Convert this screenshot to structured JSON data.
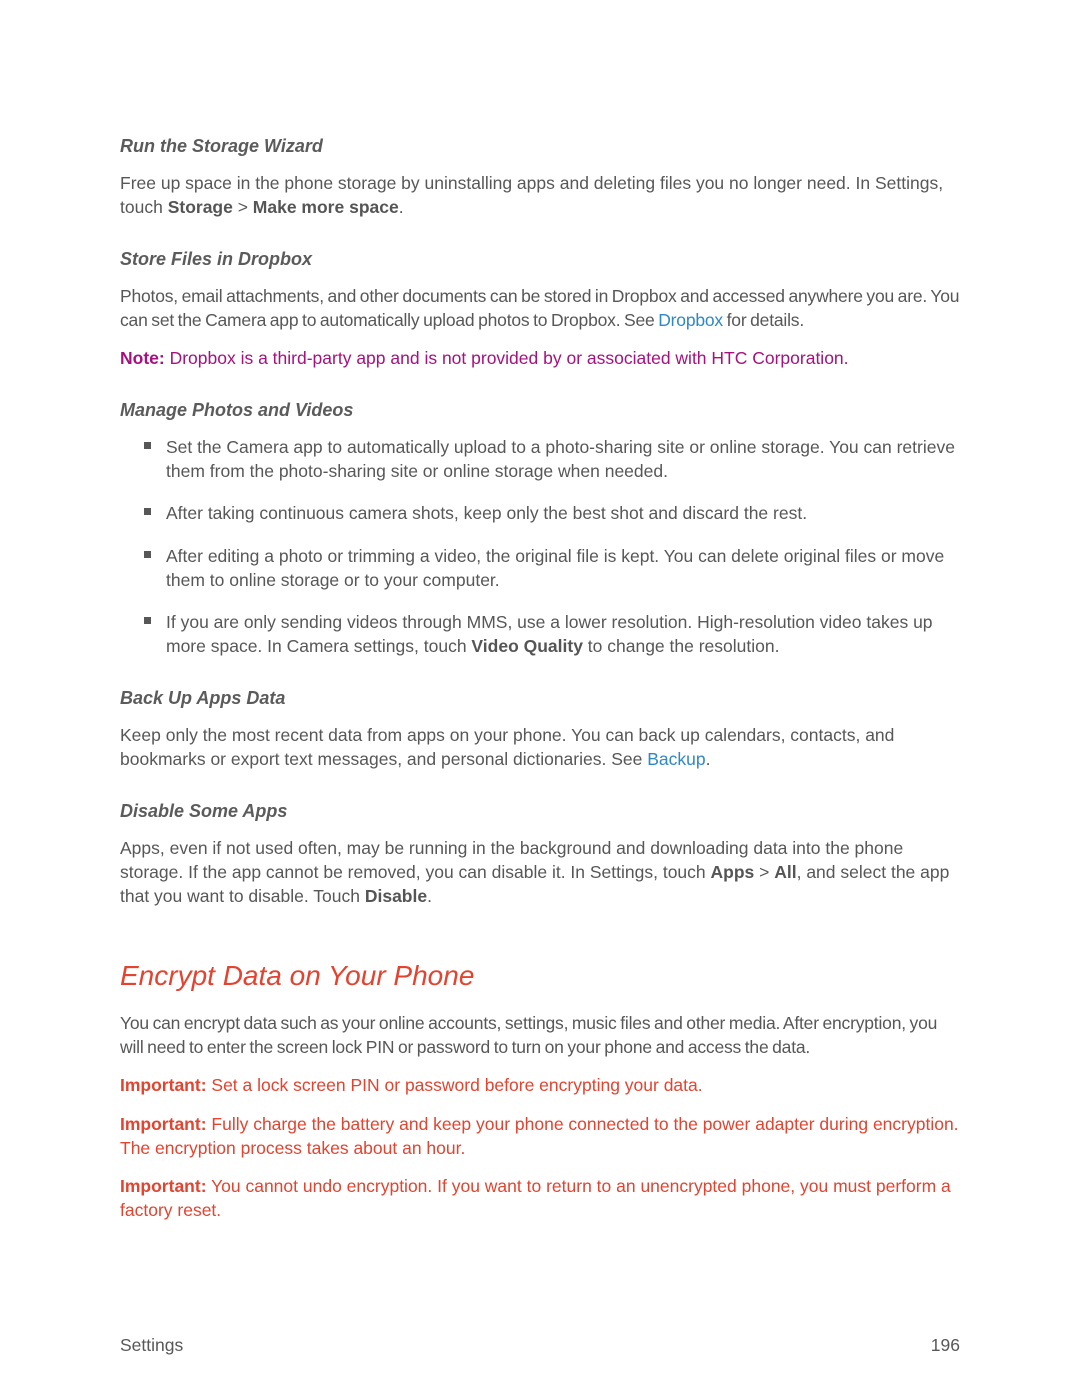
{
  "sections": {
    "storage_wizard": {
      "heading": "Run the Storage Wizard",
      "p1_a": "Free up space in the phone storage by uninstalling apps and deleting files you no longer need. In Settings, touch ",
      "p1_b1": "Storage",
      "p1_gt": " > ",
      "p1_b2": "Make more space",
      "p1_c": "."
    },
    "dropbox": {
      "heading": "Store Files in Dropbox",
      "p1_a": "Photos, email attachments, and other documents can be stored in Dropbox and accessed anywhere you are. You can set the Camera app to automatically upload photos to Dropbox. See ",
      "p1_link": "Dropbox",
      "p1_b": " for details.",
      "note_label": "Note:",
      "note_body": "  Dropbox is a third-party app and is not provided by or associated with HTC Corporation."
    },
    "photos": {
      "heading": "Manage Photos and Videos",
      "items": [
        "Set the Camera app to automatically upload to a photo-sharing site or online storage. You can retrieve them from the photo-sharing site or online storage when needed.",
        "After taking continuous camera shots, keep only the best shot and discard the rest.",
        "After editing a photo or trimming a video, the original file is kept. You can delete original files or move them to online storage or to your computer."
      ],
      "item4_a": "If you are only sending videos through MMS, use a lower resolution. High-resolution video takes up more space. In Camera settings, touch ",
      "item4_b": "Video Quality",
      "item4_c": " to change the resolution."
    },
    "backup": {
      "heading": "Back Up Apps Data",
      "p1_a": "Keep only the most recent data from apps on your phone. You can back up calendars, contacts, and bookmarks or export text messages, and personal dictionaries. See ",
      "p1_link": "Backup",
      "p1_b": "."
    },
    "disable": {
      "heading": "Disable Some Apps",
      "p1_a": "Apps, even if not used often, may be running in the background and downloading data into the phone storage. If the app cannot be removed, you can disable it. In Settings, touch ",
      "p1_b1": "Apps",
      "p1_gt": " > ",
      "p1_b2": "All",
      "p1_c": ", and select the app that you want to disable. Touch ",
      "p1_b3": "Disable",
      "p1_d": "."
    },
    "encrypt": {
      "heading": "Encrypt Data on Your Phone",
      "p1": "You can encrypt data such as your online accounts, settings, music files and other media. After encryption, you will need to enter the screen lock PIN or password to turn on your phone and access the data.",
      "imp_label": "Important:",
      "imp1": "  Set a lock screen PIN or password before encrypting your data.",
      "imp2": "  Fully charge the battery and keep your phone connected to the power adapter during encryption. The encryption process takes about an hour.",
      "imp3": "  You cannot undo encryption. If you want to return to an unencrypted phone, you must perform a factory reset."
    }
  },
  "footer": {
    "section": "Settings",
    "page": "196"
  }
}
